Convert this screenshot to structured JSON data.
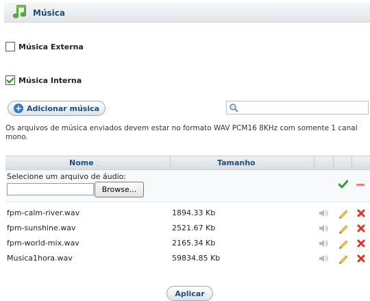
{
  "section": {
    "title": "Música"
  },
  "options": {
    "external": {
      "label": "Música Externa",
      "checked": false
    },
    "internal": {
      "label": "Música Interna",
      "checked": true
    }
  },
  "toolbar": {
    "add_label": "Adicionar música",
    "search_value": ""
  },
  "info_text": "Os arquivos de música enviados devem estar no formato WAV PCM16 8KHz com somente 1 canal mono.",
  "table": {
    "columns": {
      "name": "Nome",
      "size": "Tamanho"
    },
    "upload": {
      "label": "Selecione um arquivo de áudio:",
      "file_value": "",
      "browse_label": "Browse..."
    },
    "rows": [
      {
        "name": "fpm-calm-river.wav",
        "size": "1894.33 Kb"
      },
      {
        "name": "fpm-sunshine.wav",
        "size": "2521.67 Kb"
      },
      {
        "name": "fpm-world-mix.wav",
        "size": "2165.34 Kb"
      },
      {
        "name": "Musica1hora.wav",
        "size": "59834.85 Kb"
      }
    ]
  },
  "apply_label": "Aplicar",
  "colors": {
    "accent": "#1f4e79",
    "ok": "#2e9e2e",
    "delete": "#e03020"
  }
}
